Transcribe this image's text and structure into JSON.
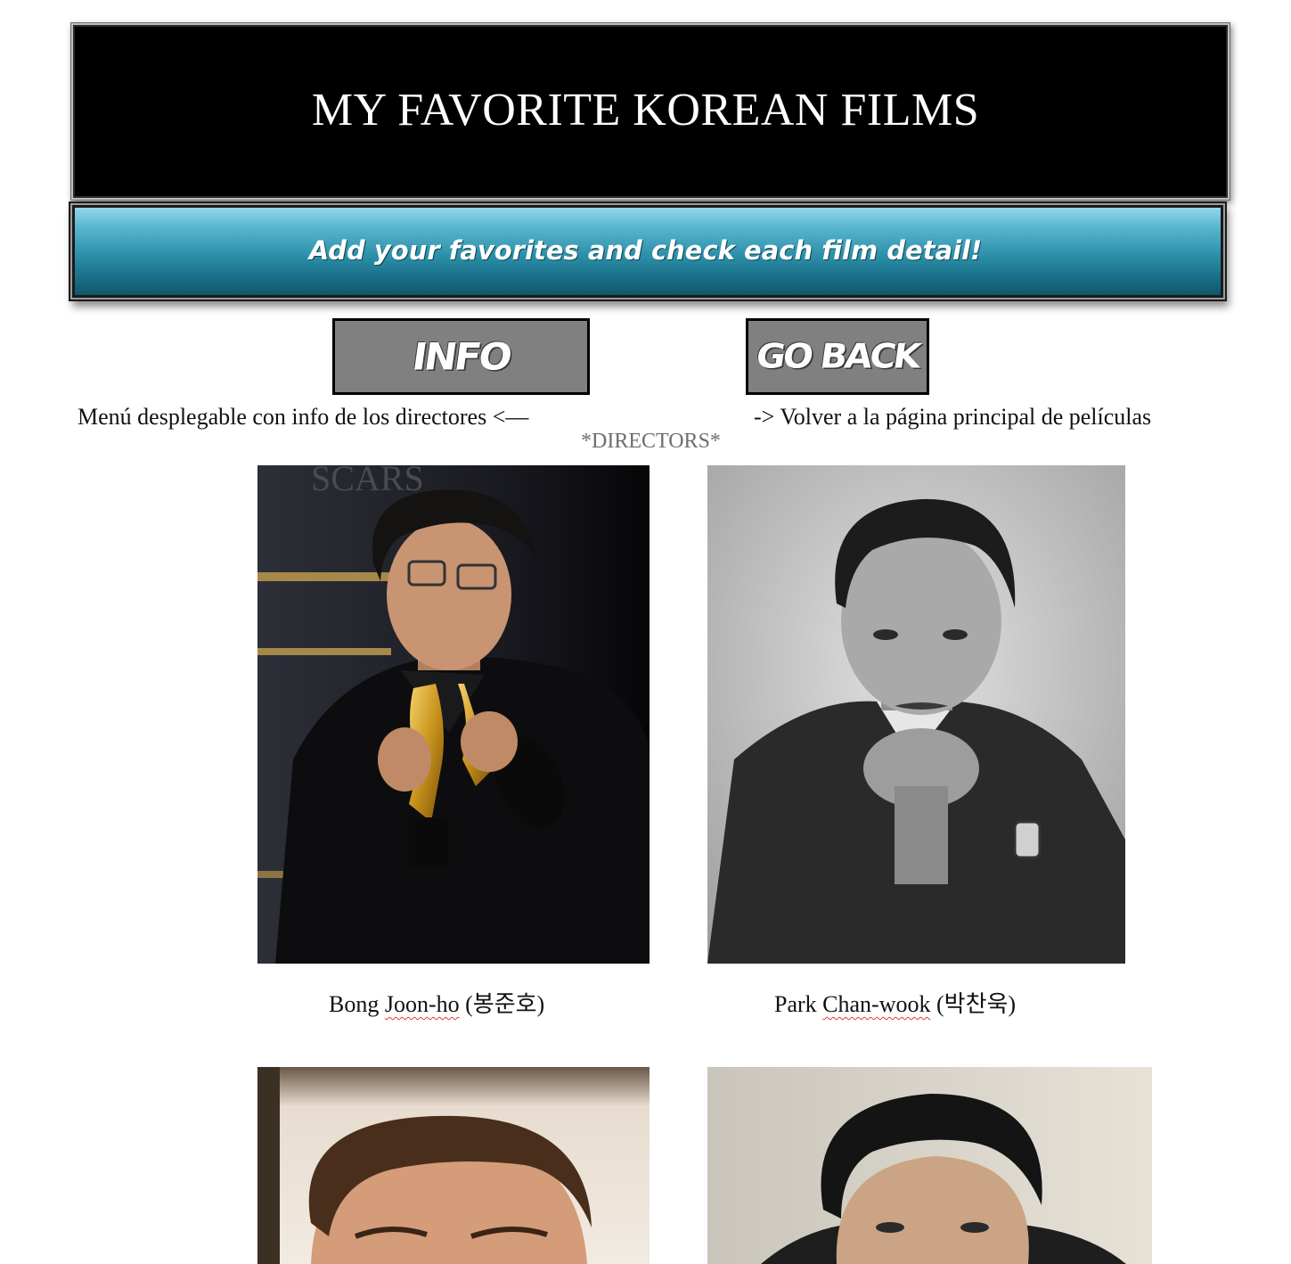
{
  "header": {
    "title": "MY FAVORITE KOREAN FILMS",
    "subtitle": "Add your favorites and check each film detail!"
  },
  "buttons": {
    "info": "INFO",
    "go_back": "GO BACK"
  },
  "hints": {
    "left": "Menú desplegable con info de los directores <—",
    "right": "-> Volver a la página principal de películas"
  },
  "section": {
    "title": "*DIRECTORS*"
  },
  "directors": [
    {
      "first": "Bong",
      "last": "Joon-ho",
      "korean": "(봉준호)"
    },
    {
      "first": "Park",
      "last": "Chan-wook",
      "korean": "(박찬욱)"
    }
  ]
}
